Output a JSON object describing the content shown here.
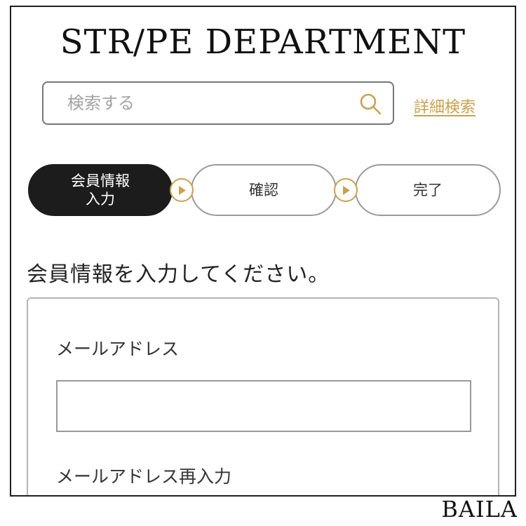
{
  "header": {
    "logo_text": "STR/PE DEPARTMENT"
  },
  "search": {
    "placeholder": "検索する",
    "value": "",
    "icon": "search-icon",
    "detail_link": "詳細検索"
  },
  "steps": [
    {
      "label": "会員情報\n入力",
      "active": true
    },
    {
      "label": "確認",
      "active": false
    },
    {
      "label": "完了",
      "active": false
    }
  ],
  "form": {
    "heading": "会員情報を入力してください。",
    "email_label": "メールアドレス",
    "email_value": "",
    "email_confirm_label": "メールアドレス再入力"
  },
  "watermark": {
    "text": "BAILA"
  },
  "colors": {
    "accent_gold": "#c9a14d",
    "active_step": "#1c1c1c",
    "border_gray": "#9a9a9a"
  }
}
